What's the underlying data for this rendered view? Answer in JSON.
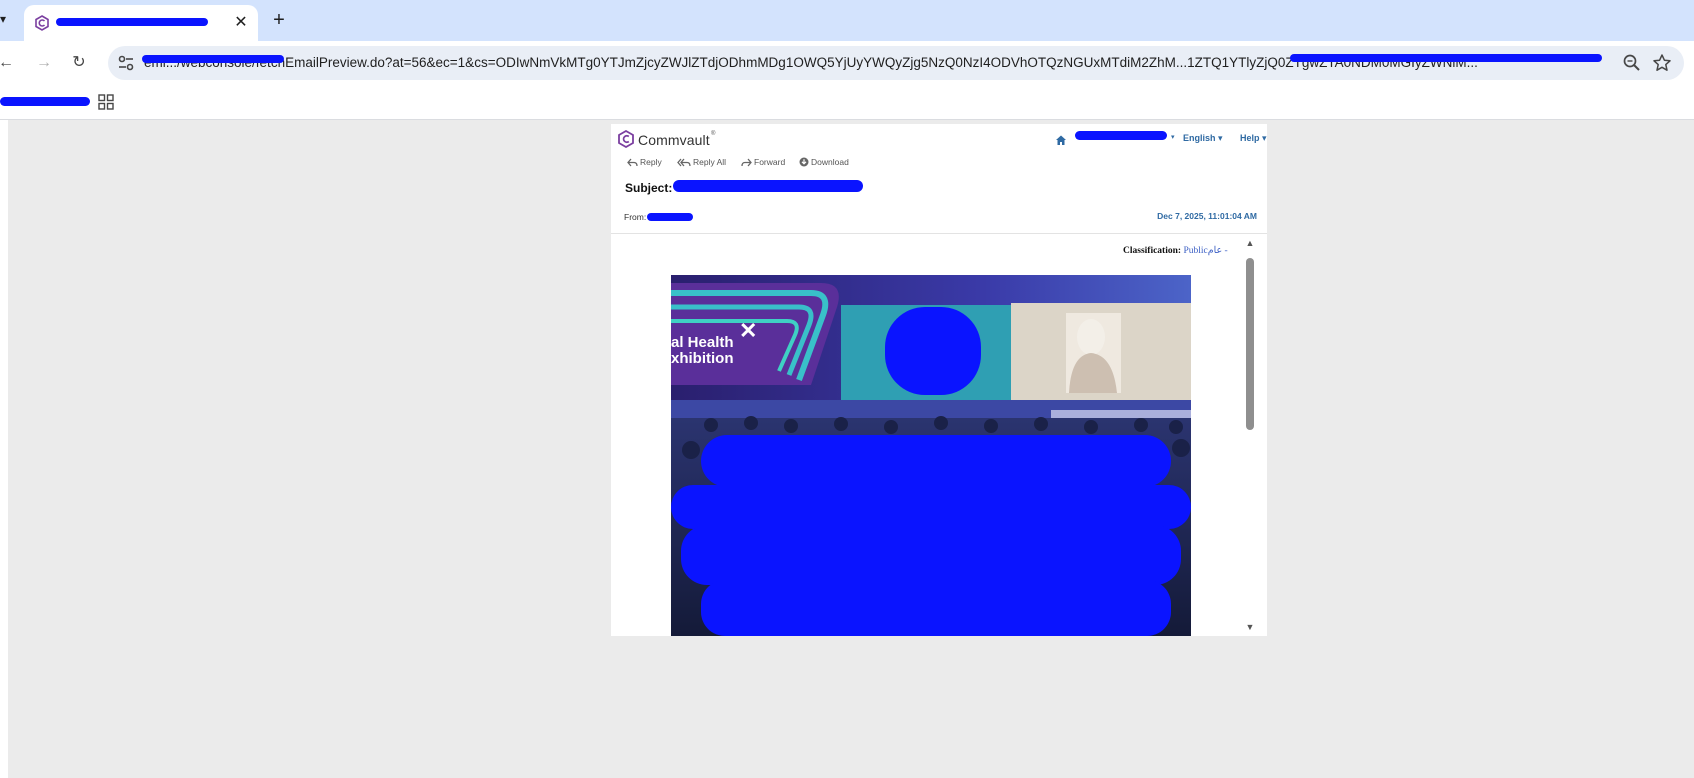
{
  "browser": {
    "tab_title": "",
    "url": "emi.../webconsole/fetchEmailPreview.do?at=56&ec=1&cs=ODIwNmVkMTg0YTJmZjcyZWJlZTdjODhmMDg1OWQ5YjUyYWQyZjg5NzQ0NzI4ODVhOTQzNGUxMTdiM2ZhM...1ZTQ1YTlyZjQ0ZTgwZTA0NDM0MGIyZWNiM...",
    "close_glyph": "✕",
    "new_tab_glyph": "+",
    "back_glyph": "←",
    "forward_glyph": "→",
    "reload_glyph": "↻",
    "tab_edge_glyph": "▾"
  },
  "app": {
    "brand": "Commvault",
    "brand_tm": "®",
    "user_caret": "▾",
    "language": "English ▾",
    "help": "Help ▾"
  },
  "email": {
    "actions": {
      "reply": "Reply",
      "reply_all": "Reply All",
      "forward": "Forward",
      "download": "Download"
    },
    "subject_label": "Subject:",
    "from_label": "From:",
    "date": "Dec 7, 2025, 11:01:04 AM",
    "classification": {
      "label": "Classification:",
      "value": "Public",
      "arabic": "عام",
      "separator": "-"
    },
    "image_text": {
      "line1": "al Health",
      "line2": "xhibition"
    }
  },
  "colors": {
    "tabstrip": "#d3e3fd",
    "link_blue": "#2f6aa3",
    "brand_purple": "#7b3fa0",
    "redaction": "#0a14ff"
  },
  "icons": [
    "commvault-logo-icon",
    "home-icon",
    "reply-icon",
    "reply-all-icon",
    "forward-icon",
    "download-icon",
    "search-zoom-icon",
    "star-icon",
    "apps-grid-icon",
    "site-info-icon"
  ]
}
